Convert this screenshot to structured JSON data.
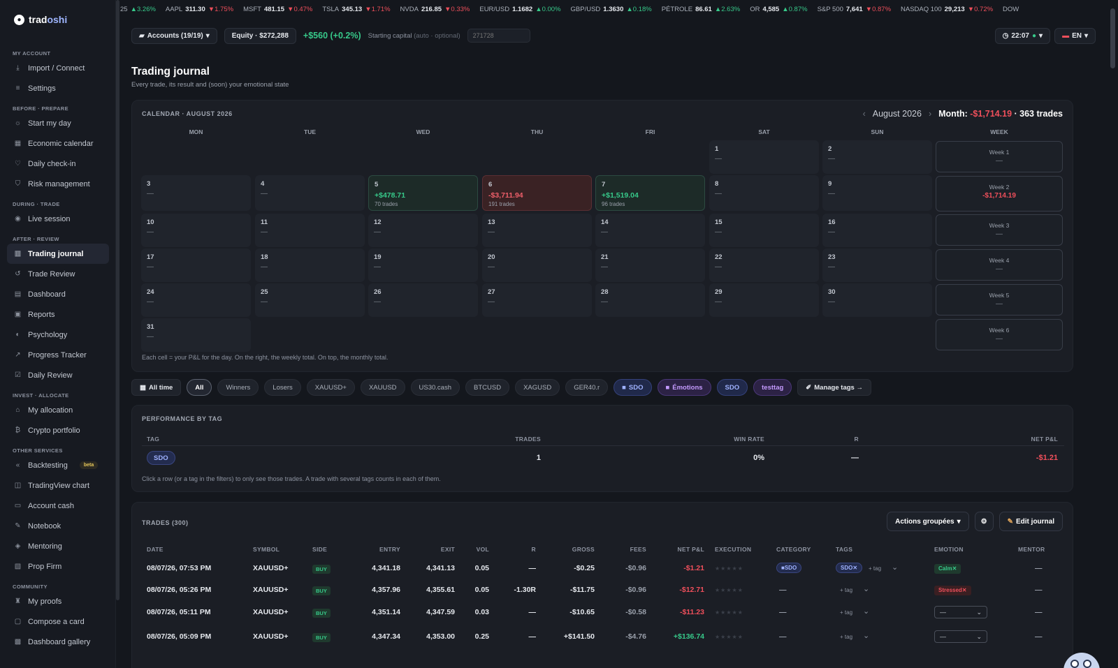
{
  "brand": {
    "name_a": "trad",
    "name_b": "oshi"
  },
  "sidebar": {
    "sections": [
      {
        "title": "MY ACCOUNT",
        "items": [
          {
            "label": "Import / Connect",
            "icon": "download-icon"
          },
          {
            "label": "Settings",
            "icon": "sliders-icon"
          }
        ]
      },
      {
        "title": "BEFORE · PREPARE",
        "items": [
          {
            "label": "Start my day",
            "icon": "sun-icon"
          },
          {
            "label": "Economic calendar",
            "icon": "calendar-icon"
          },
          {
            "label": "Daily check-in",
            "icon": "heart-icon"
          },
          {
            "label": "Risk management",
            "icon": "shield-icon"
          }
        ]
      },
      {
        "title": "DURING · TRADE",
        "items": [
          {
            "label": "Live session",
            "icon": "broadcast-icon"
          }
        ]
      },
      {
        "title": "AFTER · REVIEW",
        "items": [
          {
            "label": "Trading journal",
            "icon": "book-icon",
            "active": true
          },
          {
            "label": "Trade Review",
            "icon": "rewind-icon"
          },
          {
            "label": "Dashboard",
            "icon": "grid-icon"
          },
          {
            "label": "Reports",
            "icon": "report-icon"
          },
          {
            "label": "Psychology",
            "icon": "brain-icon"
          },
          {
            "label": "Progress Tracker",
            "icon": "trend-icon"
          },
          {
            "label": "Daily Review",
            "icon": "checklist-icon"
          }
        ]
      },
      {
        "title": "INVEST · ALLOCATE",
        "items": [
          {
            "label": "My allocation",
            "icon": "bank-icon"
          },
          {
            "label": "Crypto portfolio",
            "icon": "bitcoin-icon"
          }
        ]
      },
      {
        "title": "OTHER SERVICES",
        "items": [
          {
            "label": "Backtesting",
            "icon": "backtest-icon",
            "badge": "beta"
          },
          {
            "label": "TradingView chart",
            "icon": "chart-icon"
          },
          {
            "label": "Account cash",
            "icon": "cash-icon"
          },
          {
            "label": "Notebook",
            "icon": "notebook-icon"
          },
          {
            "label": "Mentoring",
            "icon": "mentor-icon"
          },
          {
            "label": "Prop Firm",
            "icon": "firm-icon"
          }
        ]
      },
      {
        "title": "COMMUNITY",
        "items": [
          {
            "label": "My proofs",
            "icon": "trophy-icon"
          },
          {
            "label": "Compose a card",
            "icon": "card-icon"
          },
          {
            "label": "Dashboard gallery",
            "icon": "gallery-icon"
          }
        ]
      }
    ]
  },
  "ticker": [
    {
      "sym": "25",
      "price": "",
      "chg": "3.26%",
      "dir": "up"
    },
    {
      "sym": "AAPL",
      "price": "311.30",
      "chg": "1.75%",
      "dir": "dn"
    },
    {
      "sym": "MSFT",
      "price": "481.15",
      "chg": "0.47%",
      "dir": "dn"
    },
    {
      "sym": "TSLA",
      "price": "345.13",
      "chg": "1.71%",
      "dir": "dn"
    },
    {
      "sym": "NVDA",
      "price": "216.85",
      "chg": "0.33%",
      "dir": "dn"
    },
    {
      "sym": "EUR/USD",
      "price": "1.1682",
      "chg": "0.00%",
      "dir": "up"
    },
    {
      "sym": "GBP/USD",
      "price": "1.3630",
      "chg": "0.18%",
      "dir": "up"
    },
    {
      "sym": "PÉTROLE",
      "price": "86.61",
      "chg": "2.63%",
      "dir": "up"
    },
    {
      "sym": "OR",
      "price": "4,585",
      "chg": "0.87%",
      "dir": "up"
    },
    {
      "sym": "S&P 500",
      "price": "7,641",
      "chg": "0.87%",
      "dir": "dn"
    },
    {
      "sym": "NASDAQ 100",
      "price": "29,213",
      "chg": "0.72%",
      "dir": "dn"
    },
    {
      "sym": "DOW",
      "price": "",
      "chg": "",
      "dir": ""
    }
  ],
  "topbar": {
    "accounts": "Accounts (19/19)",
    "equity": "Equity · $272,288",
    "gain": "+$560 (+0.2%)",
    "starting_label": "Starting capital",
    "starting_hint": "(auto · optional)",
    "starting_placeholder": "271728",
    "time": "22:07",
    "lang": "EN"
  },
  "page": {
    "title": "Trading journal",
    "subtitle": "Every trade, its result and (soon) your emotional state"
  },
  "calendar": {
    "title": "CALENDAR · AUGUST 2026",
    "month_label": "August 2026",
    "month_summary_label": "Month:",
    "month_pnl": "-$1,714.19",
    "month_trades": "· 363 trades",
    "weekdays": [
      "MON",
      "TUE",
      "WED",
      "THU",
      "FRI",
      "SAT",
      "SUN",
      "WEEK"
    ],
    "weeks": [
      {
        "days": [
          null,
          null,
          null,
          null,
          null,
          {
            "n": "1"
          },
          {
            "n": "2"
          }
        ],
        "week_label": "Week 1",
        "week_value": "—"
      },
      {
        "days": [
          {
            "n": "3"
          },
          {
            "n": "4"
          },
          {
            "n": "5",
            "pnl": "+$478.71",
            "trades": "70 trades",
            "state": "pos"
          },
          {
            "n": "6",
            "pnl": "-$3,711.94",
            "trades": "191 trades",
            "state": "neg"
          },
          {
            "n": "7",
            "pnl": "+$1,519.04",
            "trades": "96 trades",
            "state": "pos"
          },
          {
            "n": "8"
          },
          {
            "n": "9"
          }
        ],
        "week_label": "Week 2",
        "week_value": "-$1,714.19",
        "week_state": "neg"
      },
      {
        "days": [
          {
            "n": "10"
          },
          {
            "n": "11"
          },
          {
            "n": "12"
          },
          {
            "n": "13"
          },
          {
            "n": "14"
          },
          {
            "n": "15"
          },
          {
            "n": "16"
          }
        ],
        "week_label": "Week 3",
        "week_value": "—"
      },
      {
        "days": [
          {
            "n": "17"
          },
          {
            "n": "18"
          },
          {
            "n": "19"
          },
          {
            "n": "20"
          },
          {
            "n": "21"
          },
          {
            "n": "22"
          },
          {
            "n": "23"
          }
        ],
        "week_label": "Week 4",
        "week_value": "—"
      },
      {
        "days": [
          {
            "n": "24"
          },
          {
            "n": "25"
          },
          {
            "n": "26"
          },
          {
            "n": "27"
          },
          {
            "n": "28"
          },
          {
            "n": "29"
          },
          {
            "n": "30"
          }
        ],
        "week_label": "Week 5",
        "week_value": "—"
      },
      {
        "days": [
          {
            "n": "31"
          },
          null,
          null,
          null,
          null,
          null,
          null
        ],
        "week_label": "Week 6",
        "week_value": "—"
      }
    ],
    "empty_value": "—",
    "note": "Each cell = your P&L for the day. On the right, the weekly total. On top, the monthly total."
  },
  "filters": [
    {
      "label": "All time",
      "style": "sq",
      "icon": "calendar-icon"
    },
    {
      "label": "All",
      "style": "sel"
    },
    {
      "label": "Winners"
    },
    {
      "label": "Losers"
    },
    {
      "label": "XAUUSD+"
    },
    {
      "label": "XAUUSD"
    },
    {
      "label": "US30.cash"
    },
    {
      "label": "BTCUSD"
    },
    {
      "label": "XAGUSD"
    },
    {
      "label": "GER40.r"
    },
    {
      "label": "SDO",
      "style": "blue",
      "dot": true
    },
    {
      "label": "Émotions",
      "style": "purple",
      "dot": true
    },
    {
      "label": "SDO",
      "style": "blue"
    },
    {
      "label": "testtag",
      "style": "purple"
    },
    {
      "label": "Manage tags →",
      "style": "sq",
      "icon": "tag-icon"
    }
  ],
  "perf": {
    "title": "PERFORMANCE BY TAG",
    "headers": {
      "tag": "TAG",
      "trades": "TRADES",
      "win": "WIN RATE",
      "r": "R",
      "pnl": "NET P&L"
    },
    "rows": [
      {
        "tag": "SDO",
        "trades": "1",
        "win": "0%",
        "r": "—",
        "pnl": "-$1.21"
      }
    ],
    "note": "Click a row (or a tag in the filters) to only see those trades. A trade with several tags counts in each of them."
  },
  "trades": {
    "title": "TRADES (300)",
    "grouped_actions": "Actions groupées",
    "edit_journal": "Edit journal",
    "headers": {
      "date": "DATE",
      "symbol": "SYMBOL",
      "side": "SIDE",
      "entry": "ENTRY",
      "exit": "EXIT",
      "vol": "VOL",
      "r": "R",
      "gross": "GROSS",
      "fees": "FEES",
      "net": "NET P&L",
      "execution": "EXECUTION",
      "category": "CATEGORY",
      "tags": "TAGS",
      "emotion": "EMOTION",
      "mentor": "MENTOR"
    },
    "add_tag": "+ tag",
    "rows": [
      {
        "date": "08/07/26, 07:53 PM",
        "symbol": "XAUUSD+",
        "side": "BUY",
        "entry": "4,341.18",
        "exit": "4,341.13",
        "vol": "0.05",
        "r": "—",
        "gross": "-$0.25",
        "fees": "-$0.96",
        "net": "-$1.21",
        "net_state": "neg",
        "category": "SDO",
        "tag": "SDO",
        "emotion": "Calm",
        "emotion_state": "calm",
        "mentor": "—"
      },
      {
        "date": "08/07/26, 05:26 PM",
        "symbol": "XAUUSD+",
        "side": "BUY",
        "entry": "4,357.96",
        "exit": "4,355.61",
        "vol": "0.05",
        "r": "-1.30R",
        "gross": "-$11.75",
        "fees": "-$0.96",
        "net": "-$12.71",
        "net_state": "neg",
        "category": "—",
        "tag": "",
        "emotion": "Stressed",
        "emotion_state": "stress",
        "mentor": "—"
      },
      {
        "date": "08/07/26, 05:11 PM",
        "symbol": "XAUUSD+",
        "side": "BUY",
        "entry": "4,351.14",
        "exit": "4,347.59",
        "vol": "0.03",
        "r": "—",
        "gross": "-$10.65",
        "fees": "-$0.58",
        "net": "-$11.23",
        "net_state": "neg",
        "category": "—",
        "tag": "",
        "emotion": "—",
        "emotion_state": "select",
        "mentor": "—"
      },
      {
        "date": "08/07/26, 05:09 PM",
        "symbol": "XAUUSD+",
        "side": "BUY",
        "entry": "4,347.34",
        "exit": "4,353.00",
        "vol": "0.25",
        "r": "—",
        "gross": "+$141.50",
        "fees": "-$4.76",
        "net": "+$136.74",
        "net_state": "pos",
        "category": "—",
        "tag": "",
        "emotion": "—",
        "emotion_state": "select",
        "mentor": "—"
      }
    ]
  }
}
